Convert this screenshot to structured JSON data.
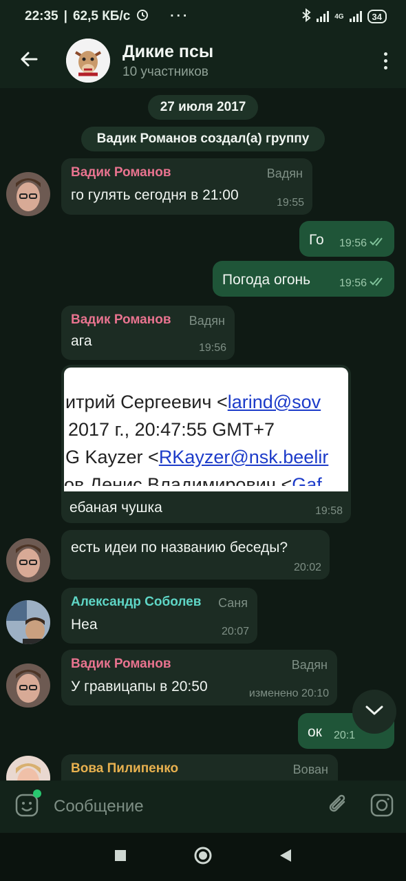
{
  "status_bar": {
    "time": "22:35",
    "speed": "62,5 КБ/с",
    "more": "···",
    "network": "4G",
    "battery": "34"
  },
  "header": {
    "title": "Дикие псы",
    "subtitle": "10 участников"
  },
  "chat": {
    "date": "27 июля 2017",
    "service": "Вадик Романов создал(а) группу",
    "messages": [
      {
        "sender": "Вадик Романов",
        "nick": "Вадян",
        "text": "го гулять сегодня в 21:00",
        "time": "19:55"
      },
      {
        "text": "Го",
        "time": "19:56"
      },
      {
        "text": "Погода огонь",
        "time": "19:56"
      },
      {
        "sender": "Вадик Романов",
        "nick": "Вадян",
        "text": "ага",
        "time": "19:56"
      },
      {
        "text": "ебаная чушка",
        "time": "19:58",
        "image_lines": [
          "итрий Сергеевич <",
          "larind@sov",
          "2017 г., 20:47:55 GMT+7",
          "G Kayzer <",
          "RKayzer@nsk.beelir",
          "ов Денис Владимирович <",
          "Gaf"
        ]
      },
      {
        "text": "есть идеи по названию беседы?",
        "time": "20:02"
      },
      {
        "sender": "Александр Соболев",
        "nick": "Саня",
        "text": "Неа",
        "time": "20:07"
      },
      {
        "sender": "Вадик Романов",
        "nick": "Вадян",
        "text": "У гравицапы в 20:50",
        "time": "изменено 20:10"
      },
      {
        "text": "ок",
        "time": "20:1"
      },
      {
        "sender": "Вова Пилипенко",
        "nick": "Вован"
      }
    ]
  },
  "input": {
    "placeholder": "Сообщение"
  },
  "colors": {
    "sender_vadik": "#e8738f",
    "sender_sasha": "#5fd6c6",
    "sender_vova": "#e8b14f",
    "outgoing_bubble": "#1f5538",
    "incoming_bubble": "#1c2c23",
    "accent_green": "#28c76f"
  },
  "icons": [
    "back-arrow-icon",
    "more-vertical-icon",
    "emoji-icon",
    "attach-icon",
    "camera-icon",
    "chevron-down-icon",
    "double-check-icon",
    "nav-square-icon",
    "nav-circle-icon",
    "nav-back-icon"
  ]
}
